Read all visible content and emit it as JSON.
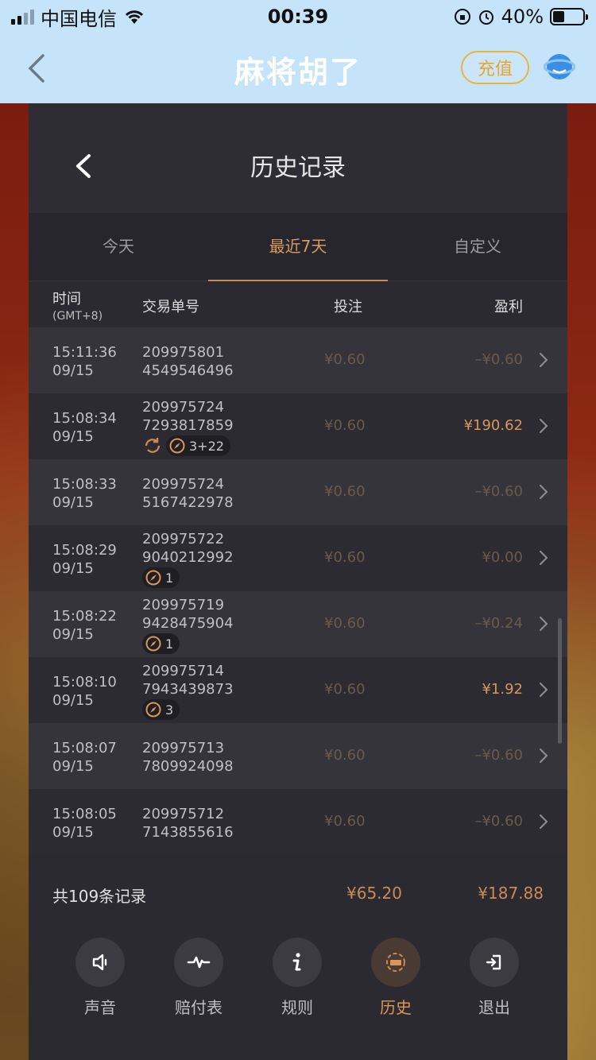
{
  "status_bar": {
    "carrier": "中国电信",
    "time": "00:39",
    "battery": "40%"
  },
  "app_nav": {
    "title": "麻将胡了",
    "recharge_label": "充值"
  },
  "panel": {
    "title": "历史记录",
    "tabs": [
      {
        "label": "今天",
        "active": false
      },
      {
        "label": "最近7天",
        "active": true
      },
      {
        "label": "自定义",
        "active": false
      }
    ],
    "columns": {
      "time": "时间",
      "timezone": "(GMT+8)",
      "order": "交易单号",
      "bet": "投注",
      "profit": "盈利"
    },
    "rows": [
      {
        "time": "15:11:36",
        "date": "09/15",
        "order1": "209975801",
        "order2": "4549546496",
        "bet": "¥0.60",
        "profit": "–¥0.60"
      },
      {
        "time": "15:08:34",
        "date": "09/15",
        "order1": "209975724",
        "order2": "7293817859",
        "bet": "¥0.60",
        "profit": "¥190.62",
        "badge": "3+22"
      },
      {
        "time": "15:08:33",
        "date": "09/15",
        "order1": "209975724",
        "order2": "5167422978",
        "bet": "¥0.60",
        "profit": "–¥0.60"
      },
      {
        "time": "15:08:29",
        "date": "09/15",
        "order1": "209975722",
        "order2": "9040212992",
        "bet": "¥0.60",
        "profit": "¥0.00",
        "badge": "1"
      },
      {
        "time": "15:08:22",
        "date": "09/15",
        "order1": "209975719",
        "order2": "9428475904",
        "bet": "¥0.60",
        "profit": "–¥0.24",
        "badge": "1"
      },
      {
        "time": "15:08:10",
        "date": "09/15",
        "order1": "209975714",
        "order2": "7943439873",
        "bet": "¥0.60",
        "profit": "¥1.92",
        "badge": "3"
      },
      {
        "time": "15:08:07",
        "date": "09/15",
        "order1": "209975713",
        "order2": "7809924098",
        "bet": "¥0.60",
        "profit": "–¥0.60"
      },
      {
        "time": "15:08:05",
        "date": "09/15",
        "order1": "209975712",
        "order2": "7143855616",
        "bet": "¥0.60",
        "profit": "–¥0.60"
      }
    ],
    "summary": {
      "count": "共109条记录",
      "total_bet": "¥65.20",
      "total_profit": "¥187.88"
    }
  },
  "toolbar": [
    {
      "label": "声音",
      "icon": "speaker-icon"
    },
    {
      "label": "赔付表",
      "icon": "pulse-icon"
    },
    {
      "label": "规则",
      "icon": "info-icon"
    },
    {
      "label": "历史",
      "icon": "history-icon"
    },
    {
      "label": "退出",
      "icon": "exit-icon"
    }
  ],
  "colors": {
    "accent": "#d9965a",
    "panel": "#2b2a31",
    "nav": "#c6e4f9",
    "recharge": "#e8b640"
  }
}
